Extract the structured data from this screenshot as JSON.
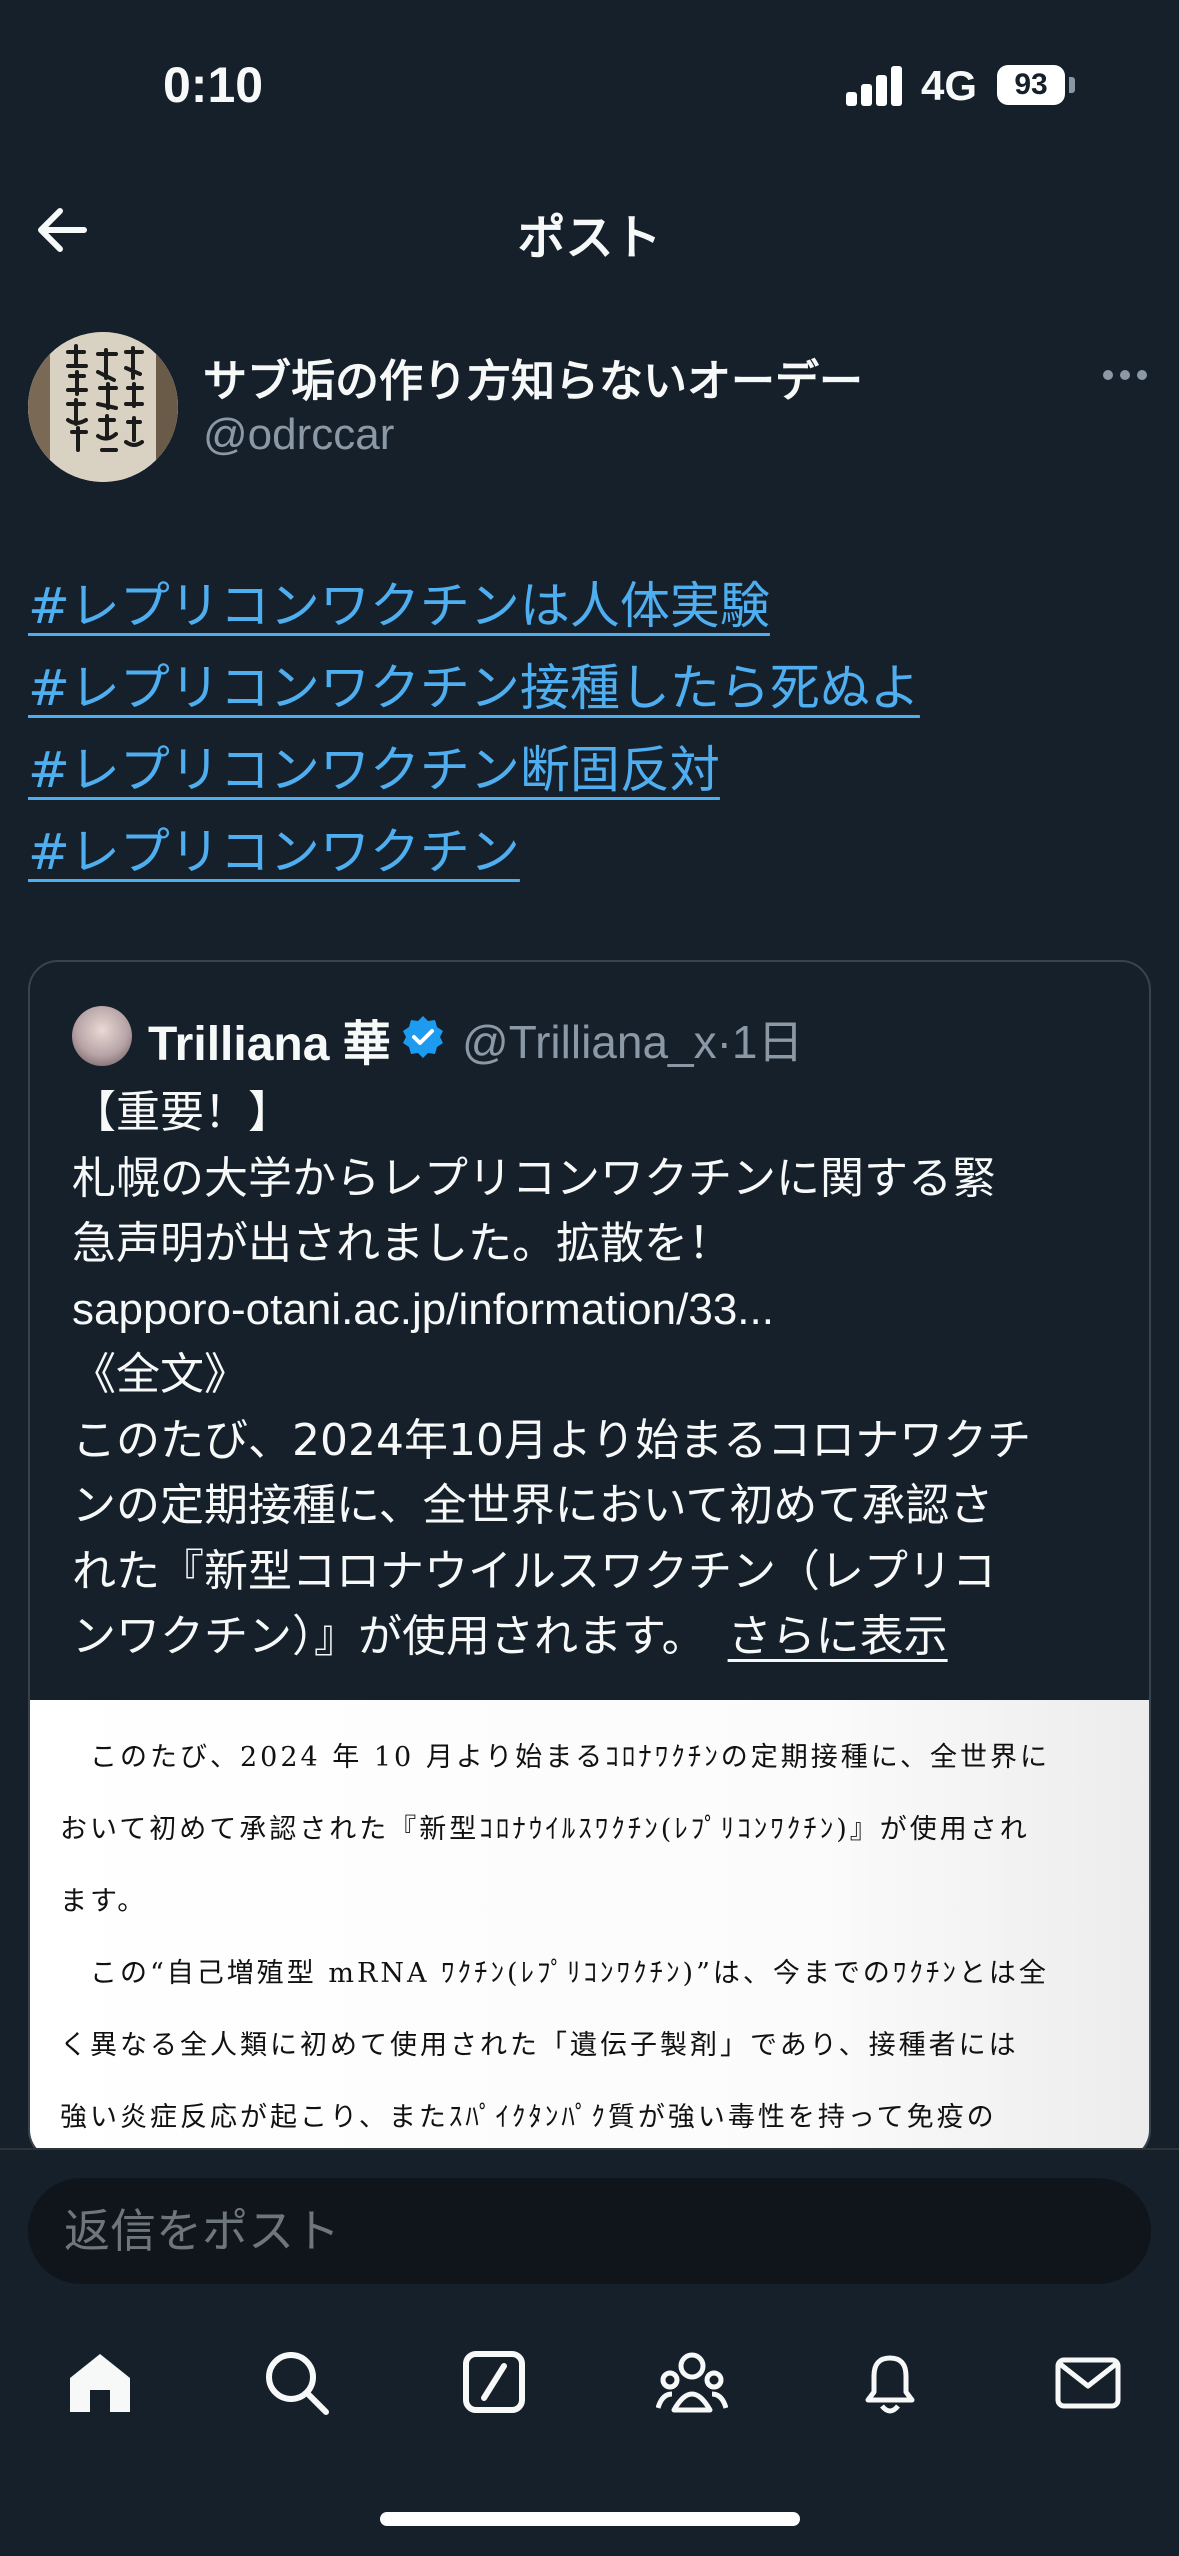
{
  "status_bar": {
    "time": "0:10",
    "network": "4G",
    "battery": "93"
  },
  "header": {
    "title": "ポスト"
  },
  "author": {
    "name": "サブ垢の作り方知らないオーデー",
    "handle": "@odrccar",
    "avatar_text": "皇國興廢在此一戰各員一層奮勵努力"
  },
  "hashtags": [
    "#レプリコンワクチンは人体実験",
    "#レプリコンワクチン接種したら死ぬよ",
    "#レプリコンワクチン断固反対",
    "#レプリコンワクチン"
  ],
  "quote": {
    "name": "Trilliana 華",
    "handle_time": "@Trilliana_x·1日",
    "lines": [
      "【重要！】",
      "札幌の大学からレプリコンワクチンに関する緊",
      "急声明が出されました。拡散を！",
      "sapporo-otani.ac.jp/information/33...",
      "《全文》",
      "このたび、2024年10月より始まるコロナワクチ",
      "ンの定期接種に、全世界において初めて承認さ",
      "れた『新型コロナウイルスワクチン（レプリコ"
    ],
    "last_line": "ンワクチン）』が使用されます。",
    "show_more": "さらに表示",
    "doc_lines": [
      "　このたび、2024 年 10 月より始まるｺﾛﾅﾜｸﾁﾝの定期接種に、全世界に",
      "おいて初めて承認された『新型ｺﾛﾅｳｲﾙｽﾜｸﾁﾝ(ﾚﾌﾟﾘｺﾝﾜｸﾁﾝ)』が使用され",
      "ます。",
      "　この“自己増殖型 mRNA ﾜｸﾁﾝ(ﾚﾌﾟﾘｺﾝﾜｸﾁﾝ)”は、今までのﾜｸﾁﾝとは全",
      "く異なる全人類に初めて使用された「遺伝子製剤」であり、接種者には",
      "強い炎症反応が起こり、またｽﾊﾟｲｸﾀﾝﾊﾟｸ質が強い毒性を持って免疫の"
    ]
  },
  "reply": {
    "placeholder": "返信をポスト"
  },
  "tabs": [
    "home-icon",
    "search-icon",
    "grok-icon",
    "communities-icon",
    "notifications-icon",
    "messages-icon"
  ],
  "colors": {
    "background": "#15202b",
    "link": "#4eaef0",
    "muted": "#8b98a5",
    "verified": "#1d9bf0"
  }
}
